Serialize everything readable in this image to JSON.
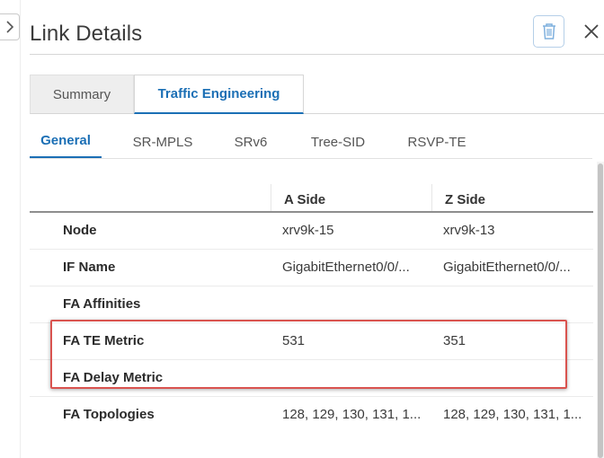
{
  "panel": {
    "title": "Link Details",
    "icons": {
      "collapse": "chevron-right-icon",
      "delete": "trash-icon",
      "close": "close-icon"
    }
  },
  "top_tabs": [
    {
      "label": "Summary",
      "active": false
    },
    {
      "label": "Traffic Engineering",
      "active": true
    }
  ],
  "sub_tabs": [
    {
      "label": "General",
      "active": true
    },
    {
      "label": "SR-MPLS",
      "active": false
    },
    {
      "label": "SRv6",
      "active": false
    },
    {
      "label": "Tree-SID",
      "active": false
    },
    {
      "label": "RSVP-TE",
      "active": false
    }
  ],
  "table": {
    "headers": {
      "label": "",
      "a_side": "A Side",
      "z_side": "Z Side"
    },
    "rows": [
      {
        "label": "Node",
        "a": "xrv9k-15",
        "z": "xrv9k-13"
      },
      {
        "label": "IF Name",
        "a": "GigabitEthernet0/0/...",
        "z": "GigabitEthernet0/0/..."
      },
      {
        "label": "FA Affinities",
        "a": "",
        "z": ""
      },
      {
        "label": "FA TE Metric",
        "a": "531",
        "z": "351"
      },
      {
        "label": "FA Delay Metric",
        "a": "",
        "z": ""
      },
      {
        "label": "FA Topologies",
        "a": "128, 129, 130, 131, 1...",
        "z": "128, 129, 130, 131, 1..."
      }
    ]
  },
  "colors": {
    "accent": "#1b6fb5",
    "highlight": "#d9534f"
  }
}
